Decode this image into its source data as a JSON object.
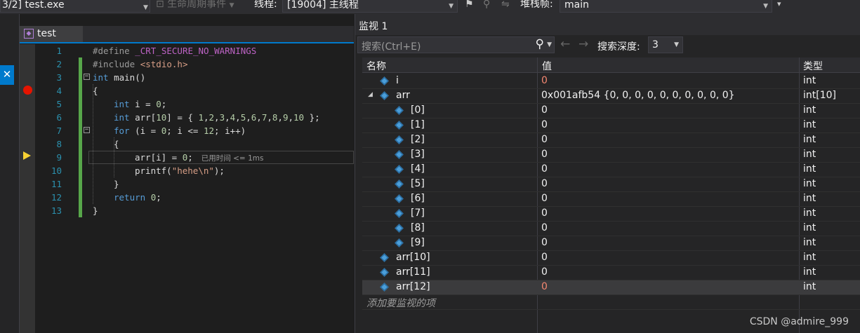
{
  "toolbar": {
    "process": "3/2] test.exe",
    "lifecycle": "生命周期事件",
    "thread_label": "线程:",
    "thread_value": "[19004] 主线程",
    "stackframe_label": "堆栈帧:",
    "stackframe_value": "main"
  },
  "editor": {
    "tab_name": "test",
    "elapsed_hint": "已用时间 <= 1ms",
    "lines": [
      {
        "num": "1"
      },
      {
        "num": "2"
      },
      {
        "num": "3"
      },
      {
        "num": "4"
      },
      {
        "num": "5"
      },
      {
        "num": "6"
      },
      {
        "num": "7"
      },
      {
        "num": "8"
      },
      {
        "num": "9"
      },
      {
        "num": "10"
      },
      {
        "num": "11"
      },
      {
        "num": "12"
      },
      {
        "num": "13"
      }
    ]
  },
  "watch": {
    "title": "监视 1",
    "search_placeholder": "搜索(Ctrl+E)",
    "depth_label": "搜索深度:",
    "depth_value": "3",
    "columns": {
      "name": "名称",
      "value": "值",
      "type": "类型"
    },
    "rows": [
      {
        "name": "i",
        "value": "0",
        "type": "int"
      },
      {
        "name": "arr",
        "value": "0x001afb54 {0, 0, 0, 0, 0, 0, 0, 0, 0, 0}",
        "type": "int[10]"
      },
      {
        "name": "[0]",
        "value": "0",
        "type": "int"
      },
      {
        "name": "[1]",
        "value": "0",
        "type": "int"
      },
      {
        "name": "[2]",
        "value": "0",
        "type": "int"
      },
      {
        "name": "[3]",
        "value": "0",
        "type": "int"
      },
      {
        "name": "[4]",
        "value": "0",
        "type": "int"
      },
      {
        "name": "[5]",
        "value": "0",
        "type": "int"
      },
      {
        "name": "[6]",
        "value": "0",
        "type": "int"
      },
      {
        "name": "[7]",
        "value": "0",
        "type": "int"
      },
      {
        "name": "[8]",
        "value": "0",
        "type": "int"
      },
      {
        "name": "[9]",
        "value": "0",
        "type": "int"
      },
      {
        "name": "arr[10]",
        "value": "0",
        "type": "int"
      },
      {
        "name": "arr[11]",
        "value": "0",
        "type": "int"
      },
      {
        "name": "arr[12]",
        "value": "0",
        "type": "int"
      }
    ],
    "add_item": "添加要监视的项"
  },
  "colors": {
    "accent": "#007acc",
    "changed_value": "#f48771",
    "breakpoint": "#e51400",
    "current_line_arrow": "#f8d133"
  },
  "watermark": "CSDN @admire_999"
}
